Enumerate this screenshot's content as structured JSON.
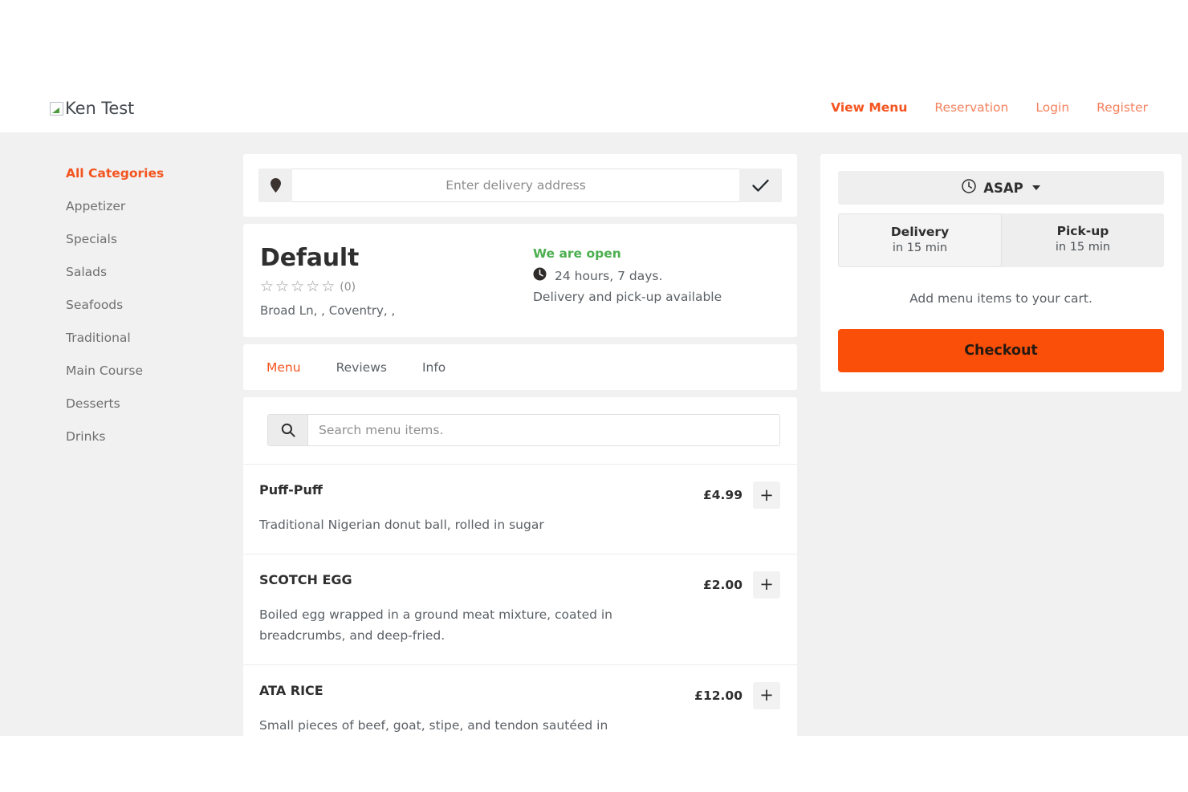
{
  "header": {
    "logo_alt": "Ken Test",
    "logo_icon": "broken-image-icon",
    "nav": [
      {
        "label": "View Menu",
        "active": true
      },
      {
        "label": "Reservation",
        "active": false
      },
      {
        "label": "Login",
        "active": false
      },
      {
        "label": "Register",
        "active": false
      }
    ]
  },
  "sidebar": {
    "categories": [
      {
        "label": "All Categories",
        "active": true
      },
      {
        "label": "Appetizer",
        "active": false
      },
      {
        "label": "Specials",
        "active": false
      },
      {
        "label": "Salads",
        "active": false
      },
      {
        "label": "Seafoods",
        "active": false
      },
      {
        "label": "Traditional",
        "active": false
      },
      {
        "label": "Main Course",
        "active": false
      },
      {
        "label": "Desserts",
        "active": false
      },
      {
        "label": "Drinks",
        "active": false
      }
    ]
  },
  "address_bar": {
    "pin_icon": "map-pin-icon",
    "placeholder": "Enter delivery address",
    "value": "",
    "confirm_icon": "check-icon"
  },
  "restaurant": {
    "name": "Default",
    "stars": [
      "☆",
      "☆",
      "☆",
      "☆",
      "☆"
    ],
    "rating_filled": 0,
    "rating_count": "(0)",
    "address": "Broad Ln, , Coventry, ,",
    "open_status": "We are open",
    "open_status_color": "#4caf50",
    "clock_icon": "clock-icon",
    "hours": "24 hours, 7 days.",
    "availability": "Delivery and pick-up available"
  },
  "tabs": [
    {
      "label": "Menu",
      "active": true
    },
    {
      "label": "Reviews",
      "active": false
    },
    {
      "label": "Info",
      "active": false
    }
  ],
  "search": {
    "icon": "search-icon",
    "placeholder": "Search menu items.",
    "value": ""
  },
  "menu_items": [
    {
      "name": "Puff-Puff",
      "description": "Traditional Nigerian donut ball, rolled in sugar",
      "price": "£4.99",
      "add_label": "+"
    },
    {
      "name": "SCOTCH EGG",
      "description": "Boiled egg wrapped in a ground meat mixture, coated in breadcrumbs, and deep-fried.",
      "price": "£2.00",
      "add_label": "+"
    },
    {
      "name": "ATA RICE",
      "description": "Small pieces of beef, goat, stipe, and tendon sautéed in",
      "price": "£12.00",
      "add_label": "+"
    }
  ],
  "order_panel": {
    "time_icon": "clock-icon",
    "time_label": "ASAP",
    "caret_icon": "chevron-down-icon",
    "modes": [
      {
        "title": "Delivery",
        "sub": "in 15 min",
        "active": true
      },
      {
        "title": "Pick-up",
        "sub": "in 15 min",
        "active": false
      }
    ],
    "empty_cart_text": "Add menu items to your cart.",
    "checkout_label": "Checkout",
    "checkout_color": "#fa4f09"
  }
}
